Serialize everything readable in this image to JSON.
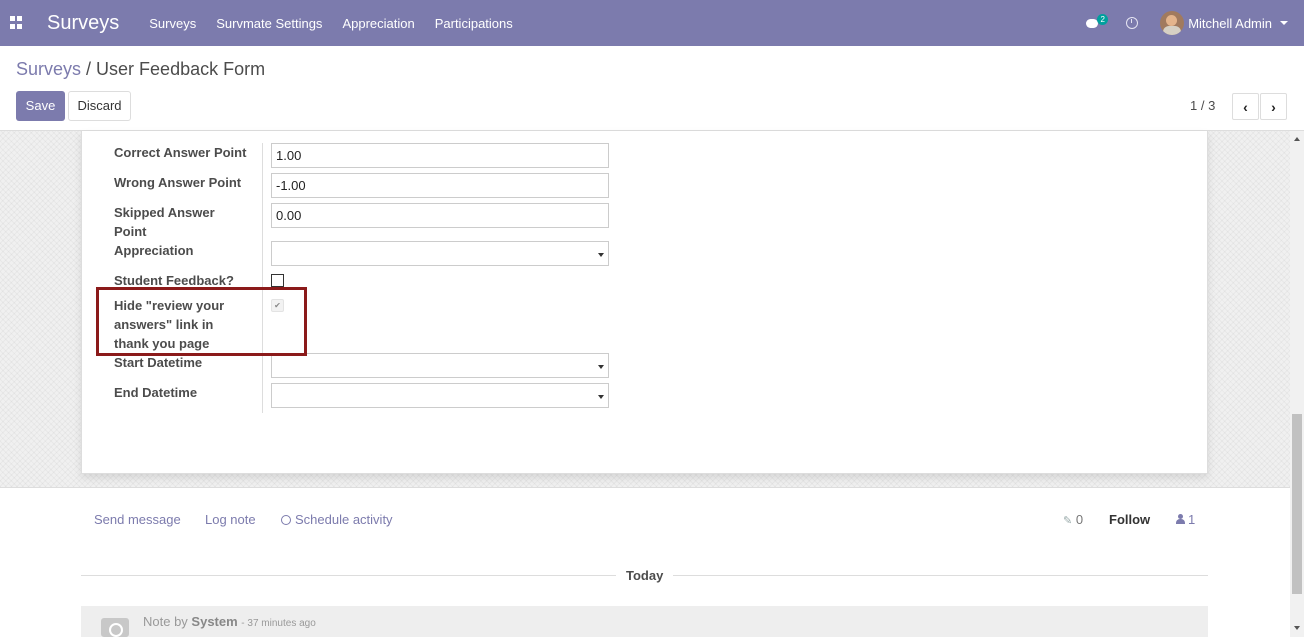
{
  "navbar": {
    "brand": "Surveys",
    "menu": [
      "Surveys",
      "Survmate Settings",
      "Appreciation",
      "Participations"
    ],
    "chat_badge": "2",
    "user": "Mitchell Admin"
  },
  "breadcrumb": {
    "parent": "Surveys",
    "separator": " / ",
    "current": "User Feedback Form"
  },
  "buttons": {
    "save": "Save",
    "discard": "Discard"
  },
  "pager": {
    "value": "1 / 3",
    "prev": "‹",
    "next": "›"
  },
  "form": {
    "correct_label": "Correct Answer Point",
    "correct_value": "1.00",
    "wrong_label": "Wrong Answer Point",
    "wrong_value": "-1.00",
    "skipped_label": "Skipped Answer Point",
    "skipped_value": "0.00",
    "appreciation_label": "Appreciation",
    "appreciation_value": "",
    "student_feedback_label": "Student Feedback?",
    "student_feedback_checked": false,
    "hide_review_label": "Hide \"review your answers\" link in thank you page",
    "hide_review_checked": true,
    "start_label": "Start Datetime",
    "start_value": "",
    "end_label": "End Datetime",
    "end_value": ""
  },
  "chatter": {
    "send_message": "Send message",
    "log_note": "Log note",
    "schedule_activity": "Schedule activity",
    "attachments": "0",
    "follow": "Follow",
    "followers": "1",
    "today": "Today",
    "note_prefix": "Note by ",
    "note_author": "System",
    "note_time": "- 37 minutes ago"
  },
  "colors": {
    "navbar": "#7c7bad",
    "highlight": "#8b1a1a"
  }
}
